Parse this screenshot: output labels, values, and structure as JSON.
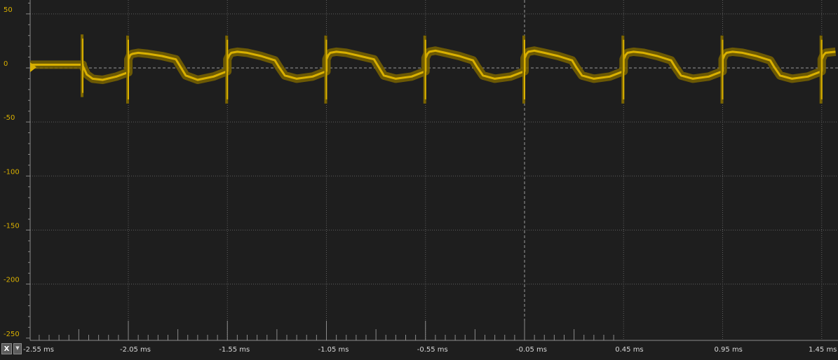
{
  "channel_color": "#d9b000",
  "x_axis_button": {
    "label": "X",
    "dropdown_icon": "triangle-down-icon"
  },
  "trigger_marker_icon": "triangle-right-icon",
  "chart_data": {
    "type": "line",
    "title": "",
    "xlabel": "",
    "ylabel": "",
    "ylim": [
      -250,
      60
    ],
    "xlim": [
      -2.57,
      1.52
    ],
    "x_unit": "ms",
    "y_ticks": [
      "50",
      "0",
      "-50",
      "-100",
      "-150",
      "-200",
      "-250"
    ],
    "y_tick_values": [
      50,
      0,
      -50,
      -100,
      -150,
      -200,
      -250
    ],
    "x_ticks": [
      "-2.55 ms",
      "-2.05 ms",
      "-1.55 ms",
      "-1.05 ms",
      "-0.55 ms",
      "-0.05 ms",
      "0.45 ms",
      "0.95 ms",
      "1.45 ms"
    ],
    "x_tick_values": [
      -2.55,
      -2.05,
      -1.55,
      -1.05,
      -0.55,
      -0.05,
      0.45,
      0.95,
      1.45
    ],
    "grid": true,
    "series": [
      {
        "x": [
          -2.57,
          -2.28,
          -2.28,
          -2.26,
          -2.23,
          -2.18,
          -2.11,
          -2.05,
          -2.05,
          -2.04,
          -2.03,
          -2.0,
          -1.95,
          -1.88,
          -1.81,
          -1.79,
          -1.76,
          -1.7,
          -1.62,
          -1.55,
          -1.55,
          -1.54,
          -1.53,
          -1.5,
          -1.45,
          -1.38,
          -1.31,
          -1.29,
          -1.26,
          -1.2,
          -1.12,
          -1.05,
          -1.05,
          -1.04,
          -1.03,
          -1.0,
          -0.95,
          -0.88,
          -0.81,
          -0.79,
          -0.76,
          -0.7,
          -0.62,
          -0.55,
          -0.55,
          -0.54,
          -0.53,
          -0.5,
          -0.45,
          -0.38,
          -0.31,
          -0.29,
          -0.26,
          -0.2,
          -0.12,
          -0.05,
          -0.05,
          -0.04,
          -0.03,
          0.0,
          0.05,
          0.12,
          0.19,
          0.21,
          0.24,
          0.3,
          0.38,
          0.45,
          0.45,
          0.46,
          0.47,
          0.5,
          0.55,
          0.62,
          0.69,
          0.71,
          0.74,
          0.8,
          0.88,
          0.95,
          0.95,
          0.96,
          0.97,
          1.0,
          1.05,
          1.12,
          1.19,
          1.21,
          1.24,
          1.3,
          1.38,
          1.45,
          1.45,
          1.46,
          1.47,
          1.52
        ],
        "y": [
          3,
          3,
          2,
          -6,
          -10,
          -11,
          -8,
          -4,
          8,
          12,
          13,
          14,
          13,
          11,
          8,
          2,
          -7,
          -11,
          -8,
          -3,
          8,
          12,
          14,
          15,
          14,
          11,
          7,
          1,
          -7,
          -10,
          -8,
          -3,
          8,
          12,
          14,
          15,
          14,
          11,
          8,
          2,
          -7,
          -10,
          -8,
          -3,
          9,
          13,
          15,
          16,
          14,
          11,
          7,
          1,
          -7,
          -10,
          -8,
          -3,
          9,
          13,
          15,
          16,
          14,
          11,
          7,
          1,
          -7,
          -10,
          -8,
          -3,
          8,
          12,
          14,
          15,
          14,
          11,
          7,
          1,
          -7,
          -10,
          -8,
          -3,
          8,
          12,
          14,
          15,
          14,
          11,
          7,
          1,
          -7,
          -10,
          -8,
          -3,
          8,
          12,
          14,
          15
        ]
      }
    ]
  }
}
